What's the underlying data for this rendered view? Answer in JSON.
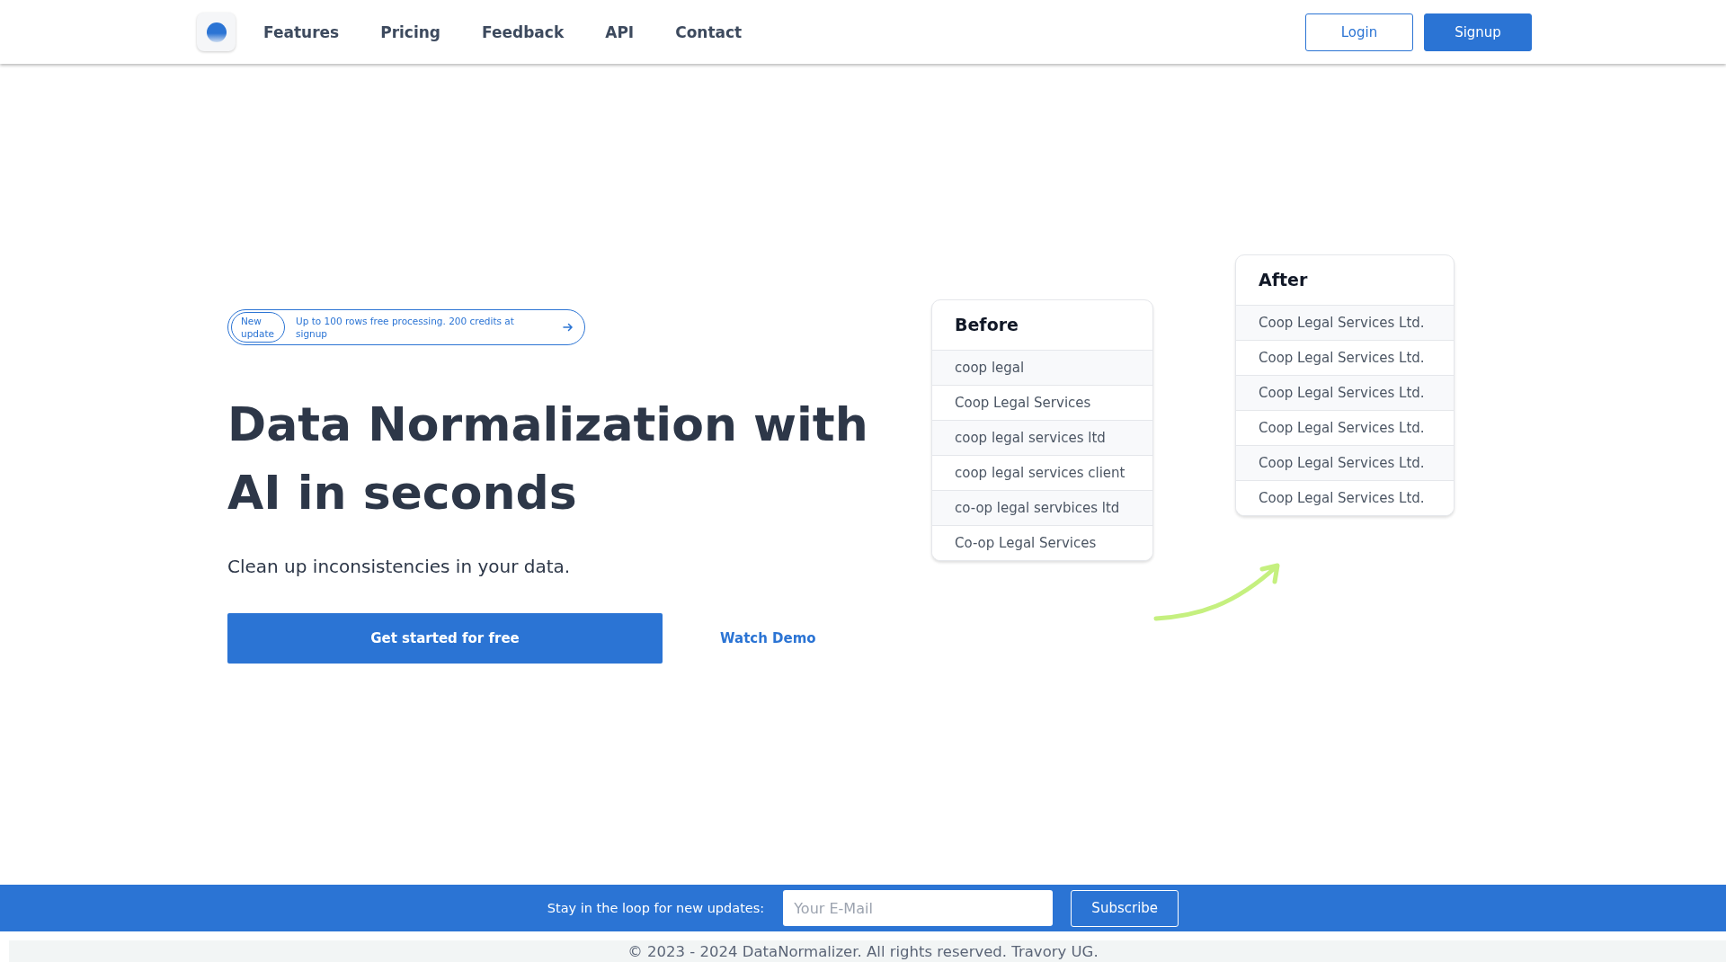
{
  "nav": {
    "items": [
      {
        "label": "Features"
      },
      {
        "label": "Pricing"
      },
      {
        "label": "Feedback"
      },
      {
        "label": "API"
      },
      {
        "label": "Contact"
      }
    ],
    "login": "Login",
    "signup": "Signup"
  },
  "hero": {
    "badge": {
      "tag": "New update",
      "text": "Up to 100 rows free processing. 200 credits at signup"
    },
    "title": "Data Normalization with AI in seconds",
    "subtitle": "Clean up inconsistencies in your data.",
    "primary_button": "Get started for free",
    "secondary_link": "Watch Demo"
  },
  "before": {
    "title": "Before",
    "rows": [
      "coop legal",
      "Coop Legal Services",
      "coop legal services ltd",
      "coop legal services client",
      "co-op legal servbices ltd",
      "Co-op Legal Services"
    ]
  },
  "after": {
    "title": "After",
    "rows": [
      "Coop Legal Services Ltd.",
      "Coop Legal Services Ltd.",
      "Coop Legal Services Ltd.",
      "Coop Legal Services Ltd.",
      "Coop Legal Services Ltd.",
      "Coop Legal Services Ltd."
    ]
  },
  "newsletter": {
    "label": "Stay in the loop for new updates:",
    "placeholder": "Your E-Mail",
    "button": "Subscribe"
  },
  "footer": {
    "copyright": "© 2023 - 2024 DataNormalizer. All rights reserved. Travory UG."
  }
}
